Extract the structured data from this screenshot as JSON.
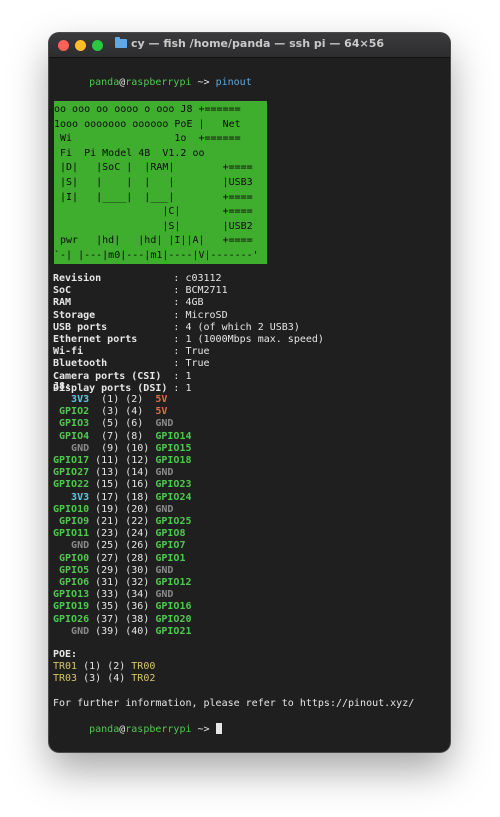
{
  "window": {
    "title": "cy — fish /home/panda — ssh pi — 64×56"
  },
  "prompt": {
    "user": "panda",
    "at": "@",
    "host": "raspberrypi",
    "path": " ~> ",
    "command": "pinout"
  },
  "board": [
    "oo ooo oo oooo o ooo J8 +======",
    "1ooo ooooooo oooooo PoE |   Net",
    " Wi                 1o  +======",
    " Fi  Pi Model 4B  V1.2 oo",
    " |D|   |SoC |  |RAM|        +====",
    " |S|   |    |  |   |        |USB3",
    " |I|   |____|  |___|        +====",
    "                  |C|       +====",
    "                  |S|       |USB2",
    " pwr   |hd|   |hd| |I||A|   +====",
    "`-| |---|m0|---|m1|----|V|-------'"
  ],
  "info": [
    {
      "label": "Revision           ",
      "value": "c03112"
    },
    {
      "label": "SoC                ",
      "value": "BCM2711"
    },
    {
      "label": "RAM                ",
      "value": "4GB"
    },
    {
      "label": "Storage            ",
      "value": "MicroSD"
    },
    {
      "label": "USB ports          ",
      "value": "4 (of which 2 USB3)"
    },
    {
      "label": "Ethernet ports     ",
      "value": "1 (1000Mbps max. speed)"
    },
    {
      "label": "Wi-fi              ",
      "value": "True"
    },
    {
      "label": "Bluetooth          ",
      "value": "True"
    },
    {
      "label": "Camera ports (CSI) ",
      "value": "1"
    },
    {
      "label": "Display ports (DSI)",
      "value": "1"
    }
  ],
  "j8_header": "J8:",
  "pins": [
    {
      "left": "3V3",
      "lc": "cyan",
      "nums": "(1) (2)",
      "right": "5V",
      "rc": "red"
    },
    {
      "left": "GPIO2",
      "lc": "green",
      "nums": "(3) (4)",
      "right": "5V",
      "rc": "red"
    },
    {
      "left": "GPIO3",
      "lc": "green",
      "nums": "(5) (6)",
      "right": "GND",
      "rc": "gray"
    },
    {
      "left": "GPIO4",
      "lc": "green",
      "nums": "(7) (8)",
      "right": "GPIO14",
      "rc": "green"
    },
    {
      "left": "GND",
      "lc": "gray",
      "nums": "(9) (10)",
      "right": "GPIO15",
      "rc": "green"
    },
    {
      "left": "GPIO17",
      "lc": "green",
      "nums": "(11) (12)",
      "right": "GPIO18",
      "rc": "green"
    },
    {
      "left": "GPIO27",
      "lc": "green",
      "nums": "(13) (14)",
      "right": "GND",
      "rc": "gray"
    },
    {
      "left": "GPIO22",
      "lc": "green",
      "nums": "(15) (16)",
      "right": "GPIO23",
      "rc": "green"
    },
    {
      "left": "3V3",
      "lc": "cyan",
      "nums": "(17) (18)",
      "right": "GPIO24",
      "rc": "green"
    },
    {
      "left": "GPIO10",
      "lc": "green",
      "nums": "(19) (20)",
      "right": "GND",
      "rc": "gray"
    },
    {
      "left": "GPIO9",
      "lc": "green",
      "nums": "(21) (22)",
      "right": "GPIO25",
      "rc": "green"
    },
    {
      "left": "GPIO11",
      "lc": "green",
      "nums": "(23) (24)",
      "right": "GPIO8",
      "rc": "green"
    },
    {
      "left": "GND",
      "lc": "gray",
      "nums": "(25) (26)",
      "right": "GPIO7",
      "rc": "green"
    },
    {
      "left": "GPIO0",
      "lc": "green",
      "nums": "(27) (28)",
      "right": "GPIO1",
      "rc": "green"
    },
    {
      "left": "GPIO5",
      "lc": "green",
      "nums": "(29) (30)",
      "right": "GND",
      "rc": "gray"
    },
    {
      "left": "GPIO6",
      "lc": "green",
      "nums": "(31) (32)",
      "right": "GPIO12",
      "rc": "green"
    },
    {
      "left": "GPIO13",
      "lc": "green",
      "nums": "(33) (34)",
      "right": "GND",
      "rc": "gray"
    },
    {
      "left": "GPIO19",
      "lc": "green",
      "nums": "(35) (36)",
      "right": "GPIO16",
      "rc": "green"
    },
    {
      "left": "GPIO26",
      "lc": "green",
      "nums": "(37) (38)",
      "right": "GPIO20",
      "rc": "green"
    },
    {
      "left": "GND",
      "lc": "gray",
      "nums": "(39) (40)",
      "right": "GPIO21",
      "rc": "green"
    }
  ],
  "poe_header": "POE:",
  "poe": [
    {
      "left": "TR01",
      "nums": "(1) (2)",
      "right": "TR00"
    },
    {
      "left": "TR03",
      "nums": "(3) (4)",
      "right": "TR02"
    }
  ],
  "footer": "For further information, please refer to https://pinout.xyz/",
  "colors": {
    "green": "#4ec94e",
    "red": "#e06c4c",
    "cyan": "#5fc9e3",
    "gray": "#8a8a8a",
    "board": "#3fae2e",
    "background": "#1f1f1f"
  }
}
